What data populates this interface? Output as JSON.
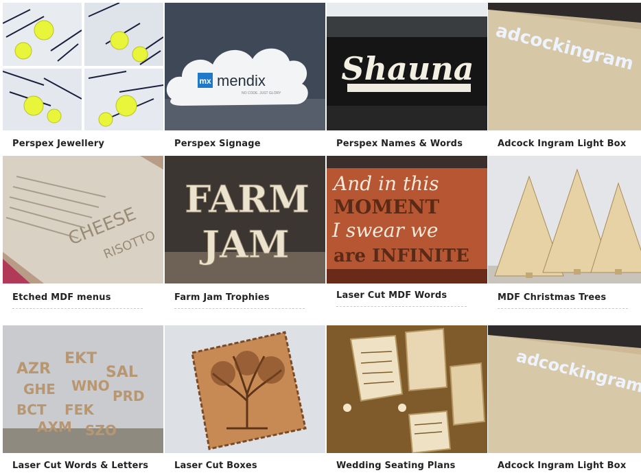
{
  "gallery": {
    "items": [
      {
        "label": "Perspex Jewellery"
      },
      {
        "label": "Perspex Signage",
        "sign_brand": "mendix",
        "sign_mark": "mx",
        "sign_tagline": "NO CODE. JUST GLORY"
      },
      {
        "label": "Perspex Names & Words",
        "word": "Shauna"
      },
      {
        "label": "Adcock Ingram Light Box",
        "lightbox_text": "adcockingram"
      },
      {
        "label": "Etched MDF menus",
        "menu_word_1": "CHEESE",
        "menu_word_2": "RISOTTO"
      },
      {
        "label": "Farm Jam Trophies",
        "trophy_word_1": "FARM",
        "trophy_word_2": "JAM"
      },
      {
        "label": "Laser Cut MDF Words",
        "line_1": "And in this",
        "line_2": "MOMENT",
        "line_3": "I swear we",
        "line_4": "are INFINITE"
      },
      {
        "label": "MDF Christmas Trees"
      },
      {
        "label": "Laser Cut Words & Letters"
      },
      {
        "label": "Laser Cut Boxes"
      },
      {
        "label": "Wedding Seating Plans"
      },
      {
        "label": "Adcock Ingram Light Box",
        "lightbox_text": "adcockingram"
      }
    ]
  }
}
